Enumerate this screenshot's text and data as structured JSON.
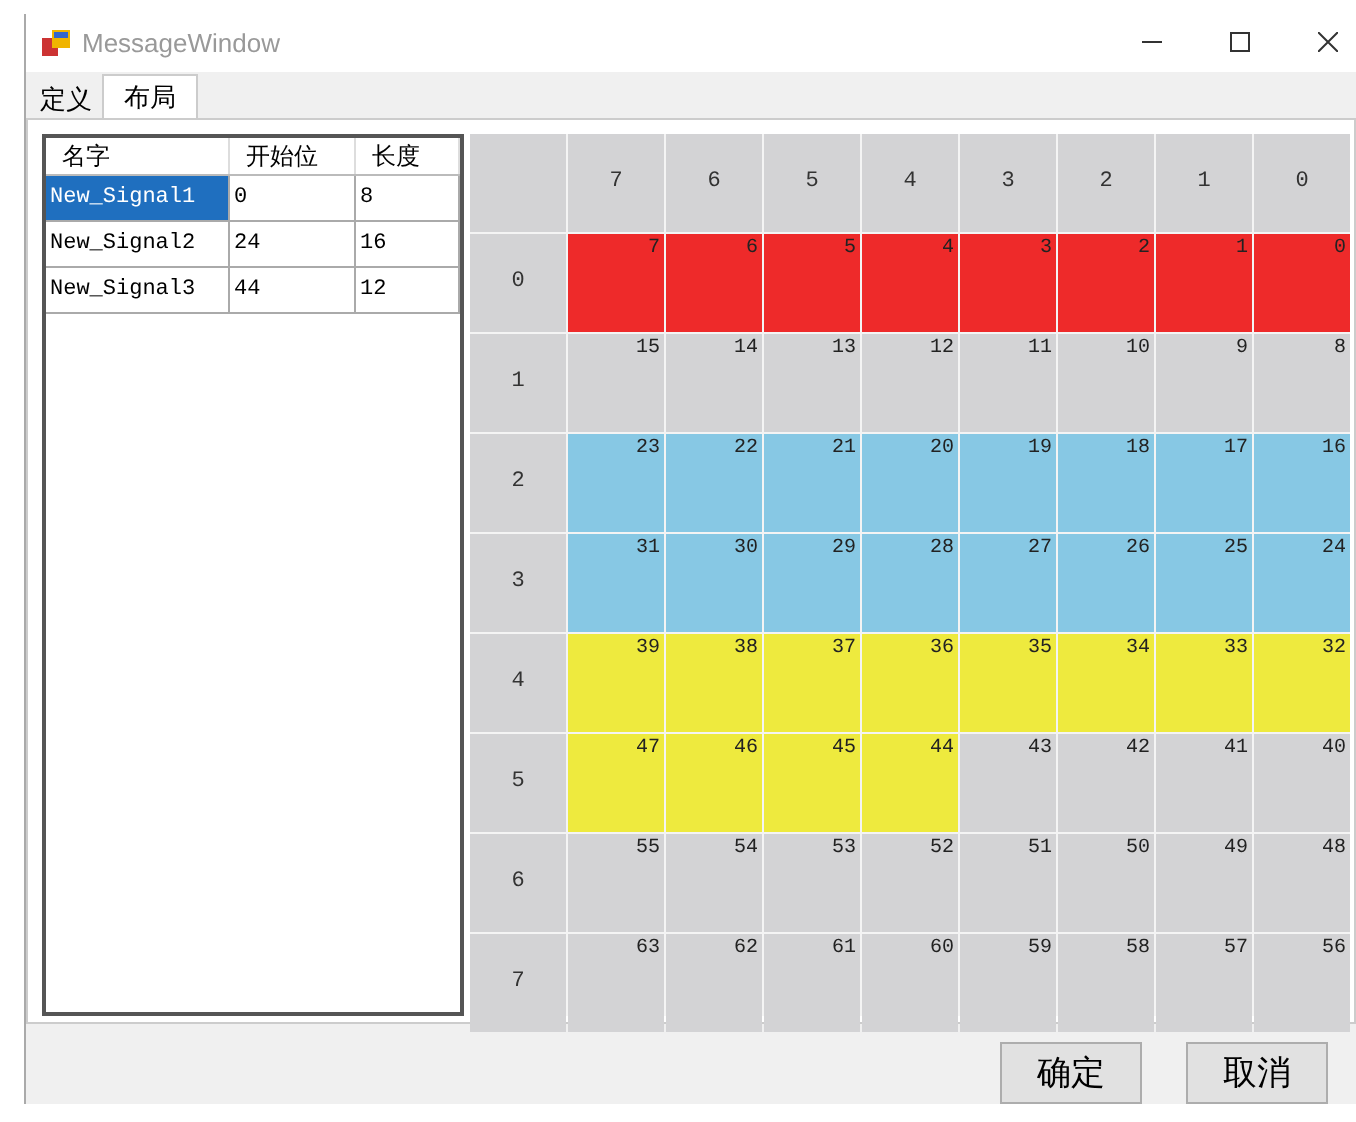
{
  "window": {
    "title": "MessageWindow"
  },
  "tabs": [
    {
      "label": "定义",
      "selected": false
    },
    {
      "label": "布局",
      "selected": true
    }
  ],
  "signals": {
    "columns": [
      "名字",
      "开始位",
      "长度"
    ],
    "rows": [
      {
        "cells": [
          "New_Signal1",
          "0",
          "8"
        ],
        "selected": true
      },
      {
        "cells": [
          "New_Signal2",
          "24",
          "16"
        ],
        "selected": false
      },
      {
        "cells": [
          "New_Signal3",
          "44",
          "12"
        ],
        "selected": false
      }
    ]
  },
  "grid": {
    "column_headers": [
      "7",
      "6",
      "5",
      "4",
      "3",
      "2",
      "1",
      "0"
    ],
    "rows": [
      {
        "header": "0",
        "cells": [
          {
            "text": "7",
            "color": "#ee2a2a"
          },
          {
            "text": "6",
            "color": "#ee2a2a"
          },
          {
            "text": "5",
            "color": "#ee2a2a"
          },
          {
            "text": "4",
            "color": "#ee2a2a"
          },
          {
            "text": "3",
            "color": "#ee2a2a"
          },
          {
            "text": "2",
            "color": "#ee2a2a"
          },
          {
            "text": "1",
            "color": "#ee2a2a"
          },
          {
            "text": "0",
            "color": "#ee2a2a"
          }
        ]
      },
      {
        "header": "1",
        "cells": [
          {
            "text": "15",
            "color": "#d3d3d5"
          },
          {
            "text": "14",
            "color": "#d3d3d5"
          },
          {
            "text": "13",
            "color": "#d3d3d5"
          },
          {
            "text": "12",
            "color": "#d3d3d5"
          },
          {
            "text": "11",
            "color": "#d3d3d5"
          },
          {
            "text": "10",
            "color": "#d3d3d5"
          },
          {
            "text": "9",
            "color": "#d3d3d5"
          },
          {
            "text": "8",
            "color": "#d3d3d5"
          }
        ]
      },
      {
        "header": "2",
        "cells": [
          {
            "text": "23",
            "color": "#87c8e4"
          },
          {
            "text": "22",
            "color": "#87c8e4"
          },
          {
            "text": "21",
            "color": "#87c8e4"
          },
          {
            "text": "20",
            "color": "#87c8e4"
          },
          {
            "text": "19",
            "color": "#87c8e4"
          },
          {
            "text": "18",
            "color": "#87c8e4"
          },
          {
            "text": "17",
            "color": "#87c8e4"
          },
          {
            "text": "16",
            "color": "#87c8e4"
          }
        ]
      },
      {
        "header": "3",
        "cells": [
          {
            "text": "31",
            "color": "#87c8e4"
          },
          {
            "text": "30",
            "color": "#87c8e4"
          },
          {
            "text": "29",
            "color": "#87c8e4"
          },
          {
            "text": "28",
            "color": "#87c8e4"
          },
          {
            "text": "27",
            "color": "#87c8e4"
          },
          {
            "text": "26",
            "color": "#87c8e4"
          },
          {
            "text": "25",
            "color": "#87c8e4"
          },
          {
            "text": "24",
            "color": "#87c8e4"
          }
        ]
      },
      {
        "header": "4",
        "cells": [
          {
            "text": "39",
            "color": "#eeea3e"
          },
          {
            "text": "38",
            "color": "#eeea3e"
          },
          {
            "text": "37",
            "color": "#eeea3e"
          },
          {
            "text": "36",
            "color": "#eeea3e"
          },
          {
            "text": "35",
            "color": "#eeea3e"
          },
          {
            "text": "34",
            "color": "#eeea3e"
          },
          {
            "text": "33",
            "color": "#eeea3e"
          },
          {
            "text": "32",
            "color": "#eeea3e"
          }
        ]
      },
      {
        "header": "5",
        "cells": [
          {
            "text": "47",
            "color": "#eeea3e"
          },
          {
            "text": "46",
            "color": "#eeea3e"
          },
          {
            "text": "45",
            "color": "#eeea3e"
          },
          {
            "text": "44",
            "color": "#eeea3e"
          },
          {
            "text": "43",
            "color": "#d3d3d5"
          },
          {
            "text": "42",
            "color": "#d3d3d5"
          },
          {
            "text": "41",
            "color": "#d3d3d5"
          },
          {
            "text": "40",
            "color": "#d3d3d5"
          }
        ]
      },
      {
        "header": "6",
        "cells": [
          {
            "text": "55",
            "color": "#d3d3d5"
          },
          {
            "text": "54",
            "color": "#d3d3d5"
          },
          {
            "text": "53",
            "color": "#d3d3d5"
          },
          {
            "text": "52",
            "color": "#d3d3d5"
          },
          {
            "text": "51",
            "color": "#d3d3d5"
          },
          {
            "text": "50",
            "color": "#d3d3d5"
          },
          {
            "text": "49",
            "color": "#d3d3d5"
          },
          {
            "text": "48",
            "color": "#d3d3d5"
          }
        ]
      },
      {
        "header": "7",
        "cells": [
          {
            "text": "63",
            "color": "#d3d3d5"
          },
          {
            "text": "62",
            "color": "#d3d3d5"
          },
          {
            "text": "61",
            "color": "#d3d3d5"
          },
          {
            "text": "60",
            "color": "#d3d3d5"
          },
          {
            "text": "59",
            "color": "#d3d3d5"
          },
          {
            "text": "58",
            "color": "#d3d3d5"
          },
          {
            "text": "57",
            "color": "#d3d3d5"
          },
          {
            "text": "56",
            "color": "#d3d3d5"
          }
        ]
      }
    ]
  },
  "buttons": [
    "确定",
    "取消"
  ]
}
